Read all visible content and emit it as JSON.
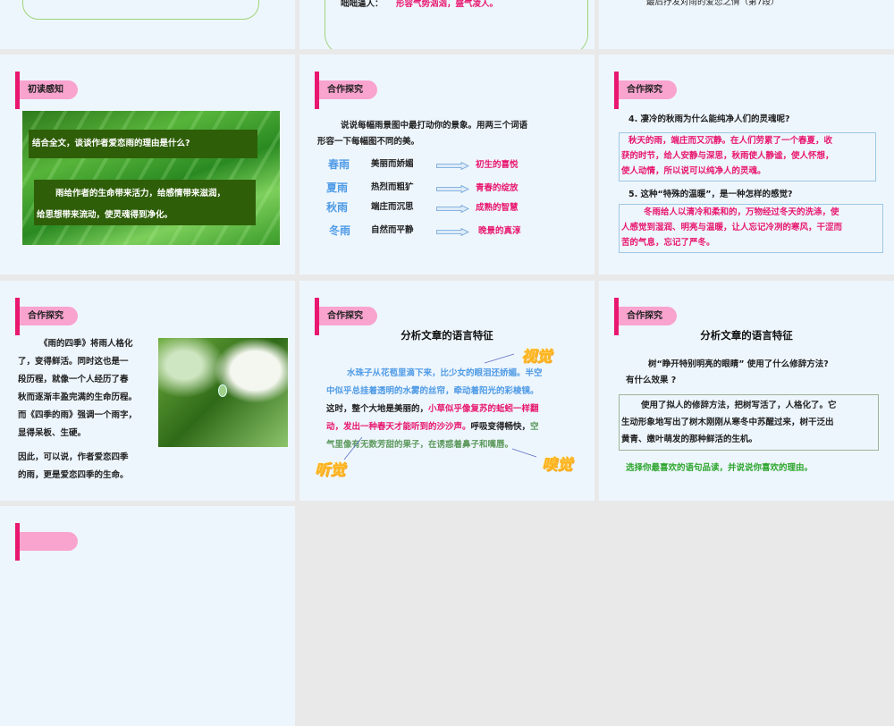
{
  "row1": {
    "slide2_term": "咄咄逼人：",
    "slide2_def": "形容气势汹汹，盛气凌人。",
    "slide3_text": "最后抒发对雨的爱恋之情（第7段）"
  },
  "s4": {
    "tag": "初读感知",
    "question": "结合全文，谈谈作者爱恋雨的理由是什么?",
    "answer_l1": "雨给作者的生命带来活力，给感情带来滋润，",
    "answer_l2": "给思想带来流动，使灵魂得到净化。"
  },
  "s5": {
    "tag": "合作探究",
    "intro_l1": "说说每幅雨景图中最打动你的景象。用两三个词语",
    "intro_l2": "形容一下每幅图不同的美。",
    "rows": [
      {
        "season": "春雨",
        "desc": "美丽而娇媚",
        "result": "初生的喜悦"
      },
      {
        "season": "夏雨",
        "desc": "热烈而粗犷",
        "result": "青春的绽放"
      },
      {
        "season": "秋雨",
        "desc": "端庄而沉思",
        "result": "成熟的智慧"
      },
      {
        "season": "冬雨",
        "desc": "自然而平静",
        "result": "晚景的真淳"
      }
    ]
  },
  "s6": {
    "tag": "合作探究",
    "q4": "4. 凄冷的秋雨为什么能纯净人们的灵魂呢?",
    "a4": [
      "秋天的雨，端庄而又沉静。在人们劳累了一个春夏，收",
      "获的时节，给人安静与深思，秋雨使人静谧，使人怀想，",
      "使人动情，所以说可以纯净人的灵魂。"
    ],
    "q5": "5. 这种“特殊的温暖”，是一种怎样的感觉?",
    "a5": [
      "冬雨给人以清冷和柔和的，万物经过冬天的洗涤，使",
      "人感觉到湿润、明亮与温暖，让人忘记冷冽的寒风，干涩而",
      "苦的气息，忘记了严冬。"
    ]
  },
  "s7": {
    "tag": "合作探究",
    "lines": [
      "《雨的四季》将雨人格化",
      "了，变得鲜活。同时这也是一",
      "段历程，就像一个人经历了春",
      "秋而逐渐丰盈完满的生命历程。",
      "而《四季的雨》强调一个雨字，",
      "显得呆板、生硬。"
    ],
    "conclusion": [
      "因此，可以说，作者爱恋四季",
      "的雨，更是爱恋四季的生命。"
    ]
  },
  "s8": {
    "tag": "合作探究",
    "title": "分析文章的语言特征",
    "p1": "水珠子从花苞里滴下来，比少女的眼泪还娇媚。半空",
    "p2": "中似乎总挂着透明的水雾的丝帘，牵动着阳光的彩棱镜。",
    "p3a": "这时，整个大地是美丽的，",
    "p3b": "小草似乎像复苏的蚯蚓一样翻",
    "p4a": "动，发出一种春天才能听到的沙沙声。",
    "p4b": "呼吸变得畅快，",
    "p4c": "空",
    "p5": "气里像有无数芳甜的果子，在诱惑着鼻子和嘴唇。",
    "sight": "视觉",
    "hearing": "听觉",
    "smell": "嗅觉"
  },
  "s9": {
    "tag": "合作探究",
    "title": "分析文章的语言特征",
    "q1": "树“睁开特别明亮的眼睛” 使用了什么修辞方法?",
    "q2": "有什么效果 ?",
    "a": [
      "使用了拟人的修辞方法，把树写活了，人格化了。它",
      "生动形象地写出了树木刚刚从寒冬中苏醒过来，树干泛出",
      "黄青、嫩叶萌发的那种鲜活的生机。"
    ],
    "prompt": "选择你最喜欢的语句品读，并说说你喜欢的理由。"
  }
}
